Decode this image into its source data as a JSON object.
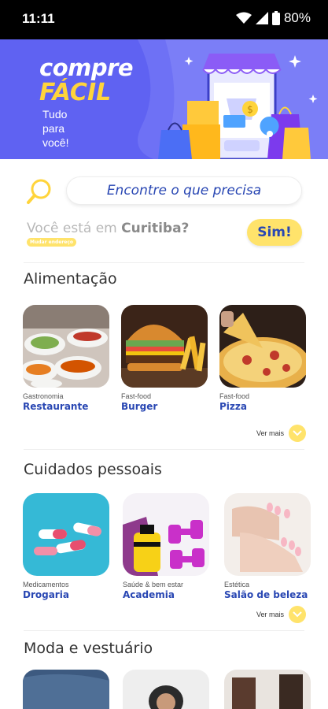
{
  "status_bar": {
    "time": "11:11",
    "battery": "80%"
  },
  "banner": {
    "title_line1": "compre",
    "title_line2": "FÁCIL",
    "tagline_line1": "Tudo",
    "tagline_line2": "para",
    "tagline_line3": "você!"
  },
  "search": {
    "placeholder": "Encontre o que precisa"
  },
  "location": {
    "prefix": "Você está em ",
    "city": "Curitiba?",
    "change_label": "Mudar endereço",
    "confirm_button": "Sim!"
  },
  "sections": [
    {
      "title": "Alimentação",
      "more_label": "Ver mais",
      "items": [
        {
          "category": "Gastronomia",
          "name": "Restaurante"
        },
        {
          "category": "Fast-food",
          "name": "Burger"
        },
        {
          "category": "Fast-food",
          "name": "Pizza"
        }
      ]
    },
    {
      "title": "Cuidados pessoais",
      "more_label": "Ver mais",
      "items": [
        {
          "category": "Medicamentos",
          "name": "Drogaria"
        },
        {
          "category": "Saúde & bem estar",
          "name": "Academia"
        },
        {
          "category": "Estética",
          "name": "Salão de beleza"
        }
      ]
    },
    {
      "title": "Moda e vestuário",
      "items": []
    }
  ],
  "colors": {
    "brand_blue": "#2947b3",
    "banner_purple": "#5f62f2",
    "accent_yellow": "#ffe36b"
  }
}
